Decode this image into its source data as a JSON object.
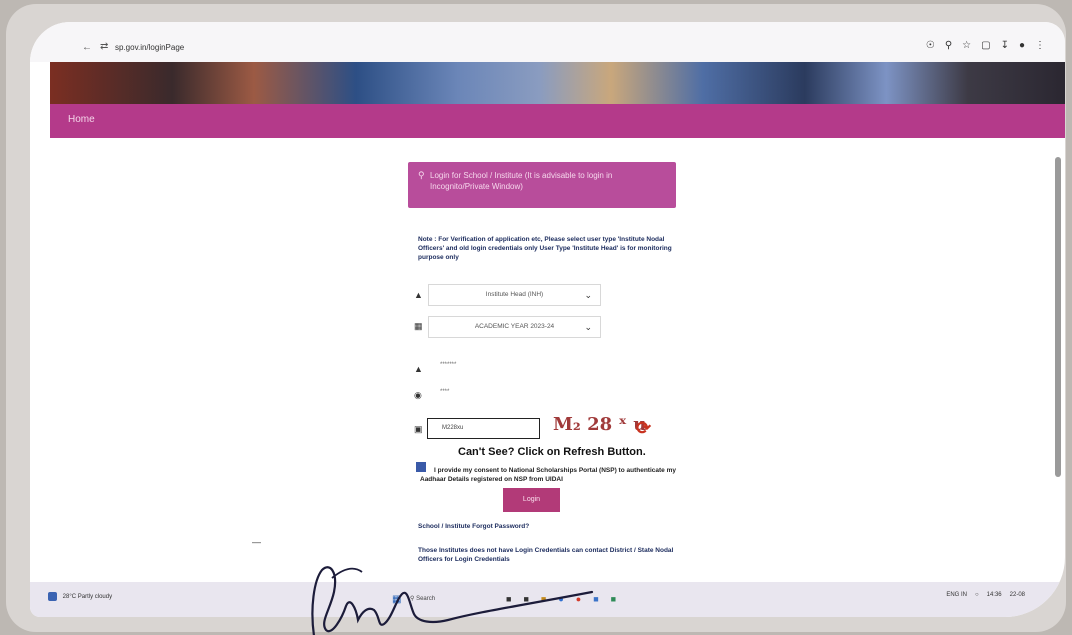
{
  "browser": {
    "url": "sp.gov.in/loginPage",
    "actions": [
      "key",
      "zoom",
      "star",
      "ext",
      "download",
      "profile",
      "menu"
    ]
  },
  "nav": {
    "home_label": "Home"
  },
  "login_card": {
    "header": "Login for School / Institute (It is advisable to login in Incognito/Private Window)",
    "note": "Note : For Verification of application etc, Please select user type 'Institute Nodal Officers' and old login credentials only User Type 'Institute Head' is for monitoring purpose only",
    "user_type": "Institute Head (INH)",
    "academic_year": "ACADEMIC YEAR 2023-24",
    "username_value": "*******",
    "password_value": "****",
    "captcha_input": "M228xu",
    "captcha_text": "M₂ 28 ˣ u",
    "cant_see": "Can't See? Click on Refresh Button.",
    "consent": "I provide my consent to National Scholarships Portal (NSP) to authenticate my Aadhaar Details registered on NSP from UIDAI",
    "login_button": "Login",
    "forgot": "School / Institute Forgot Password?",
    "contact": "Those Institutes does not have Login Credentials can contact District / State Nodal Officers for Login Credentials"
  },
  "taskbar": {
    "weather_temp": "28°C",
    "weather_desc": "Partly cloudy",
    "search_placeholder": "Search",
    "tray_lang": "ENG IN",
    "tray_time": "14:36",
    "tray_date": "22-08"
  },
  "colors": {
    "navbar": "#b43a8a",
    "login_header": "#b84d9b",
    "login_button": "#b23a78"
  }
}
